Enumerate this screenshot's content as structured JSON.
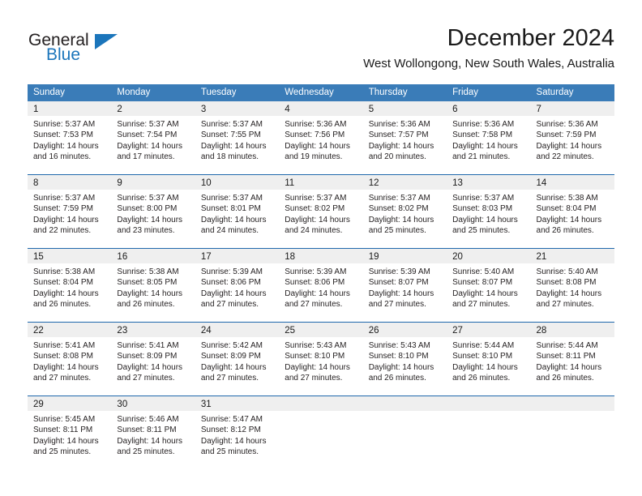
{
  "brand": {
    "name_part1": "General",
    "name_part2": "Blue"
  },
  "header": {
    "title": "December 2024",
    "subtitle": "West Wollongong, New South Wales, Australia"
  },
  "colors": {
    "header_row_bg": "#3a7cb8",
    "week_separator": "#1f68ac",
    "day_band_bg": "#efefef",
    "brand_blue": "#1b75bb",
    "text": "#231f20"
  },
  "weekdays": [
    "Sunday",
    "Monday",
    "Tuesday",
    "Wednesday",
    "Thursday",
    "Friday",
    "Saturday"
  ],
  "weeks": [
    [
      {
        "day": "1",
        "sunrise": "Sunrise: 5:37 AM",
        "sunset": "Sunset: 7:53 PM",
        "daylight1": "Daylight: 14 hours",
        "daylight2": "and 16 minutes."
      },
      {
        "day": "2",
        "sunrise": "Sunrise: 5:37 AM",
        "sunset": "Sunset: 7:54 PM",
        "daylight1": "Daylight: 14 hours",
        "daylight2": "and 17 minutes."
      },
      {
        "day": "3",
        "sunrise": "Sunrise: 5:37 AM",
        "sunset": "Sunset: 7:55 PM",
        "daylight1": "Daylight: 14 hours",
        "daylight2": "and 18 minutes."
      },
      {
        "day": "4",
        "sunrise": "Sunrise: 5:36 AM",
        "sunset": "Sunset: 7:56 PM",
        "daylight1": "Daylight: 14 hours",
        "daylight2": "and 19 minutes."
      },
      {
        "day": "5",
        "sunrise": "Sunrise: 5:36 AM",
        "sunset": "Sunset: 7:57 PM",
        "daylight1": "Daylight: 14 hours",
        "daylight2": "and 20 minutes."
      },
      {
        "day": "6",
        "sunrise": "Sunrise: 5:36 AM",
        "sunset": "Sunset: 7:58 PM",
        "daylight1": "Daylight: 14 hours",
        "daylight2": "and 21 minutes."
      },
      {
        "day": "7",
        "sunrise": "Sunrise: 5:36 AM",
        "sunset": "Sunset: 7:59 PM",
        "daylight1": "Daylight: 14 hours",
        "daylight2": "and 22 minutes."
      }
    ],
    [
      {
        "day": "8",
        "sunrise": "Sunrise: 5:37 AM",
        "sunset": "Sunset: 7:59 PM",
        "daylight1": "Daylight: 14 hours",
        "daylight2": "and 22 minutes."
      },
      {
        "day": "9",
        "sunrise": "Sunrise: 5:37 AM",
        "sunset": "Sunset: 8:00 PM",
        "daylight1": "Daylight: 14 hours",
        "daylight2": "and 23 minutes."
      },
      {
        "day": "10",
        "sunrise": "Sunrise: 5:37 AM",
        "sunset": "Sunset: 8:01 PM",
        "daylight1": "Daylight: 14 hours",
        "daylight2": "and 24 minutes."
      },
      {
        "day": "11",
        "sunrise": "Sunrise: 5:37 AM",
        "sunset": "Sunset: 8:02 PM",
        "daylight1": "Daylight: 14 hours",
        "daylight2": "and 24 minutes."
      },
      {
        "day": "12",
        "sunrise": "Sunrise: 5:37 AM",
        "sunset": "Sunset: 8:02 PM",
        "daylight1": "Daylight: 14 hours",
        "daylight2": "and 25 minutes."
      },
      {
        "day": "13",
        "sunrise": "Sunrise: 5:37 AM",
        "sunset": "Sunset: 8:03 PM",
        "daylight1": "Daylight: 14 hours",
        "daylight2": "and 25 minutes."
      },
      {
        "day": "14",
        "sunrise": "Sunrise: 5:38 AM",
        "sunset": "Sunset: 8:04 PM",
        "daylight1": "Daylight: 14 hours",
        "daylight2": "and 26 minutes."
      }
    ],
    [
      {
        "day": "15",
        "sunrise": "Sunrise: 5:38 AM",
        "sunset": "Sunset: 8:04 PM",
        "daylight1": "Daylight: 14 hours",
        "daylight2": "and 26 minutes."
      },
      {
        "day": "16",
        "sunrise": "Sunrise: 5:38 AM",
        "sunset": "Sunset: 8:05 PM",
        "daylight1": "Daylight: 14 hours",
        "daylight2": "and 26 minutes."
      },
      {
        "day": "17",
        "sunrise": "Sunrise: 5:39 AM",
        "sunset": "Sunset: 8:06 PM",
        "daylight1": "Daylight: 14 hours",
        "daylight2": "and 27 minutes."
      },
      {
        "day": "18",
        "sunrise": "Sunrise: 5:39 AM",
        "sunset": "Sunset: 8:06 PM",
        "daylight1": "Daylight: 14 hours",
        "daylight2": "and 27 minutes."
      },
      {
        "day": "19",
        "sunrise": "Sunrise: 5:39 AM",
        "sunset": "Sunset: 8:07 PM",
        "daylight1": "Daylight: 14 hours",
        "daylight2": "and 27 minutes."
      },
      {
        "day": "20",
        "sunrise": "Sunrise: 5:40 AM",
        "sunset": "Sunset: 8:07 PM",
        "daylight1": "Daylight: 14 hours",
        "daylight2": "and 27 minutes."
      },
      {
        "day": "21",
        "sunrise": "Sunrise: 5:40 AM",
        "sunset": "Sunset: 8:08 PM",
        "daylight1": "Daylight: 14 hours",
        "daylight2": "and 27 minutes."
      }
    ],
    [
      {
        "day": "22",
        "sunrise": "Sunrise: 5:41 AM",
        "sunset": "Sunset: 8:08 PM",
        "daylight1": "Daylight: 14 hours",
        "daylight2": "and 27 minutes."
      },
      {
        "day": "23",
        "sunrise": "Sunrise: 5:41 AM",
        "sunset": "Sunset: 8:09 PM",
        "daylight1": "Daylight: 14 hours",
        "daylight2": "and 27 minutes."
      },
      {
        "day": "24",
        "sunrise": "Sunrise: 5:42 AM",
        "sunset": "Sunset: 8:09 PM",
        "daylight1": "Daylight: 14 hours",
        "daylight2": "and 27 minutes."
      },
      {
        "day": "25",
        "sunrise": "Sunrise: 5:43 AM",
        "sunset": "Sunset: 8:10 PM",
        "daylight1": "Daylight: 14 hours",
        "daylight2": "and 27 minutes."
      },
      {
        "day": "26",
        "sunrise": "Sunrise: 5:43 AM",
        "sunset": "Sunset: 8:10 PM",
        "daylight1": "Daylight: 14 hours",
        "daylight2": "and 26 minutes."
      },
      {
        "day": "27",
        "sunrise": "Sunrise: 5:44 AM",
        "sunset": "Sunset: 8:10 PM",
        "daylight1": "Daylight: 14 hours",
        "daylight2": "and 26 minutes."
      },
      {
        "day": "28",
        "sunrise": "Sunrise: 5:44 AM",
        "sunset": "Sunset: 8:11 PM",
        "daylight1": "Daylight: 14 hours",
        "daylight2": "and 26 minutes."
      }
    ],
    [
      {
        "day": "29",
        "sunrise": "Sunrise: 5:45 AM",
        "sunset": "Sunset: 8:11 PM",
        "daylight1": "Daylight: 14 hours",
        "daylight2": "and 25 minutes."
      },
      {
        "day": "30",
        "sunrise": "Sunrise: 5:46 AM",
        "sunset": "Sunset: 8:11 PM",
        "daylight1": "Daylight: 14 hours",
        "daylight2": "and 25 minutes."
      },
      {
        "day": "31",
        "sunrise": "Sunrise: 5:47 AM",
        "sunset": "Sunset: 8:12 PM",
        "daylight1": "Daylight: 14 hours",
        "daylight2": "and 25 minutes."
      },
      {
        "day": "",
        "sunrise": "",
        "sunset": "",
        "daylight1": "",
        "daylight2": ""
      },
      {
        "day": "",
        "sunrise": "",
        "sunset": "",
        "daylight1": "",
        "daylight2": ""
      },
      {
        "day": "",
        "sunrise": "",
        "sunset": "",
        "daylight1": "",
        "daylight2": ""
      },
      {
        "day": "",
        "sunrise": "",
        "sunset": "",
        "daylight1": "",
        "daylight2": ""
      }
    ]
  ]
}
